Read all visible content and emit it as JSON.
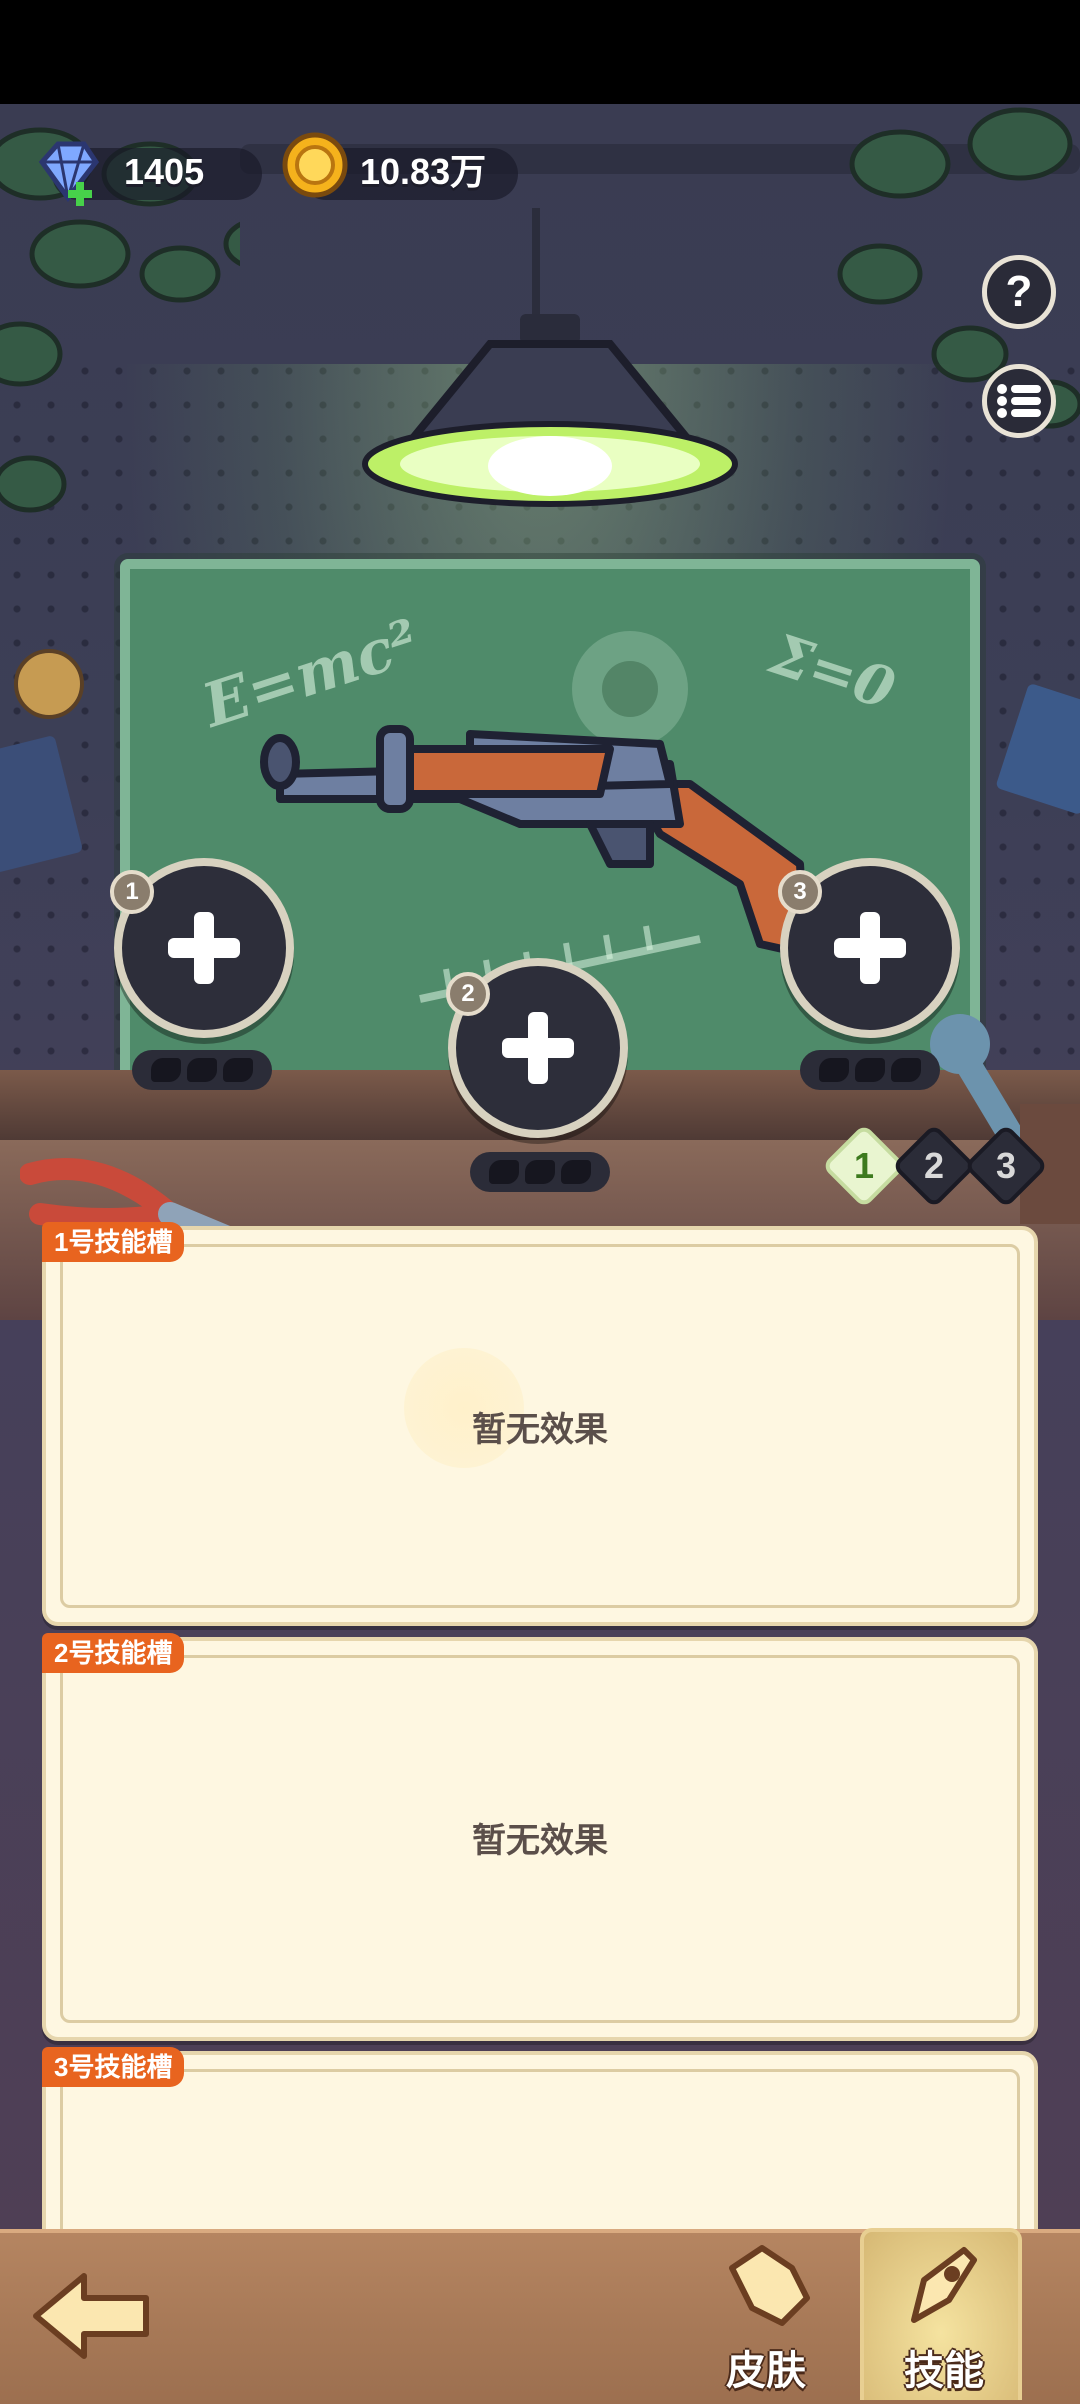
{
  "currency": {
    "gems": "1405",
    "coins": "10.83万"
  },
  "chalkboard": {
    "formula_left": "E=mc²",
    "formula_right": "Σ=0"
  },
  "slots": [
    {
      "number": "1"
    },
    {
      "number": "2"
    },
    {
      "number": "3"
    }
  ],
  "page_tabs": [
    {
      "label": "1",
      "active": true
    },
    {
      "label": "2",
      "active": false
    },
    {
      "label": "3",
      "active": false
    }
  ],
  "cards": [
    {
      "tag": "1号技能槽",
      "empty_text": "暂无效果"
    },
    {
      "tag": "2号技能槽",
      "empty_text": "暂无效果"
    },
    {
      "tag": "3号技能槽",
      "empty_text": ""
    }
  ],
  "bottom_nav": {
    "skin_label": "皮肤",
    "skill_label": "技能"
  },
  "colors": {
    "accent_orange": "#e8641f",
    "card_bg": "#fef7e1",
    "bottom_bar": "#a97a57",
    "active_tab": "#e9f5d0"
  },
  "icons": {
    "gem": "gem-icon",
    "coin": "coin-icon",
    "help": "help-icon",
    "list": "list-icon",
    "back": "back-arrow-icon",
    "skin": "skin-icon",
    "skill": "skill-icon"
  }
}
